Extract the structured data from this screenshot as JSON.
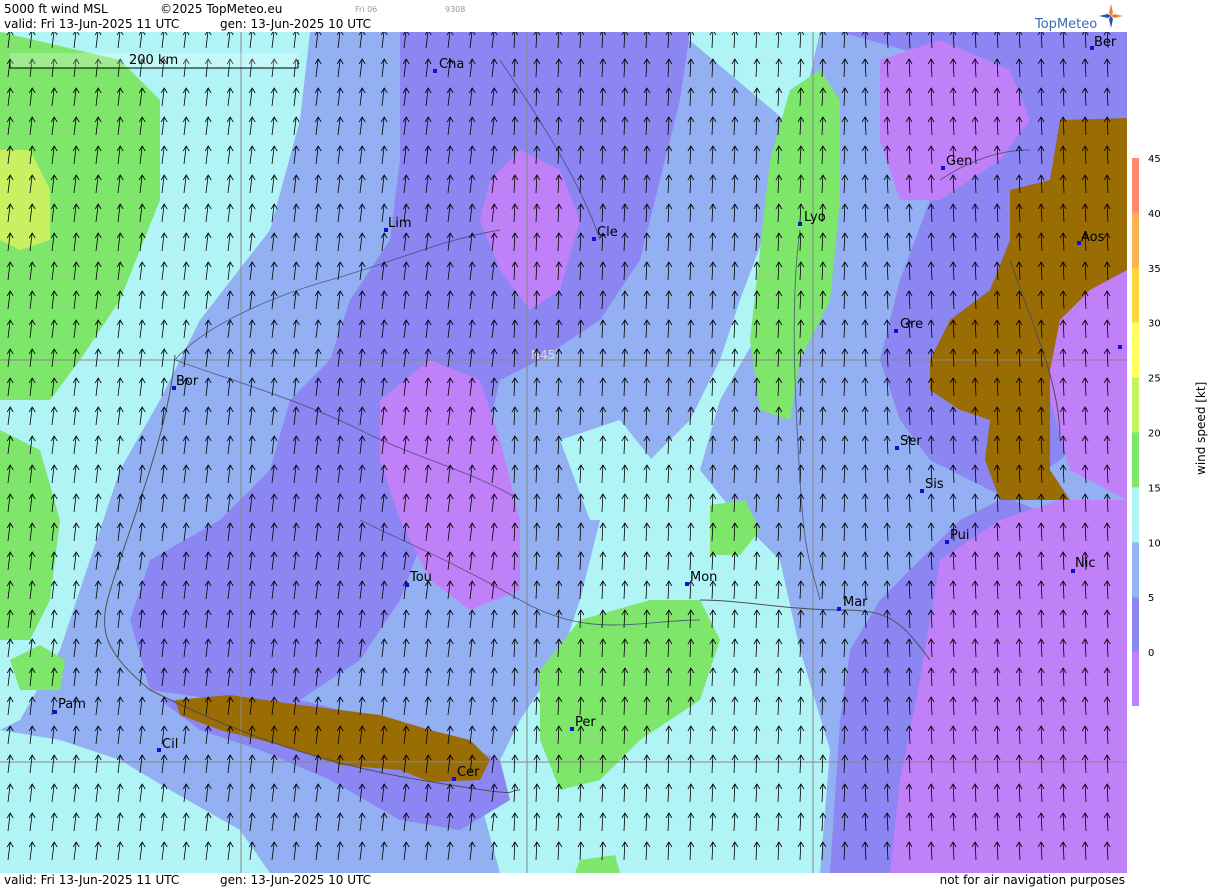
{
  "header": {
    "title": "5000 ft wind MSL",
    "copyright": "©2025 TopMeteo.eu",
    "day_code": "Fri 06",
    "code2": "9308",
    "valid": "valid:  Fri  13-Jun-2025  11 UTC",
    "gen": "gen: 13-Jun-2025 10 UTC",
    "brand": "TopMeteo"
  },
  "map": {
    "scale_label": "200 km",
    "lat_label": "N45",
    "cities": [
      {
        "name": "Cha"
      },
      {
        "name": "Ber"
      },
      {
        "name": "Lim"
      },
      {
        "name": "Cle"
      },
      {
        "name": "Lyo"
      },
      {
        "name": "Gen"
      },
      {
        "name": "Aos"
      },
      {
        "name": "Gre"
      },
      {
        "name": "Bor"
      },
      {
        "name": "Ser"
      },
      {
        "name": "Sis"
      },
      {
        "name": "Pui"
      },
      {
        "name": "Nic"
      },
      {
        "name": "Tou"
      },
      {
        "name": "Mon"
      },
      {
        "name": "Mar"
      },
      {
        "name": "Pam"
      },
      {
        "name": "Cil"
      },
      {
        "name": "Per"
      },
      {
        "name": "Cer"
      }
    ]
  },
  "legend": {
    "unit_label": "wind speed [kt]",
    "ticks": [
      "45",
      "40",
      "35",
      "30",
      "25",
      "20",
      "15",
      "10",
      "5",
      "0"
    ],
    "colors": [
      "#ff8a70",
      "#ffb050",
      "#ffd840",
      "#ffff60",
      "#c8f060",
      "#7ee66a",
      "#b0f4f6",
      "#92b6f4",
      "#8c86f2",
      "#c080f8"
    ]
  },
  "footer": {
    "valid": "valid:  Fri  13-Jun-2025  11 UTC",
    "gen": "gen: 13-Jun-2025 10 UTC",
    "note": "not for air navigation purposes"
  }
}
